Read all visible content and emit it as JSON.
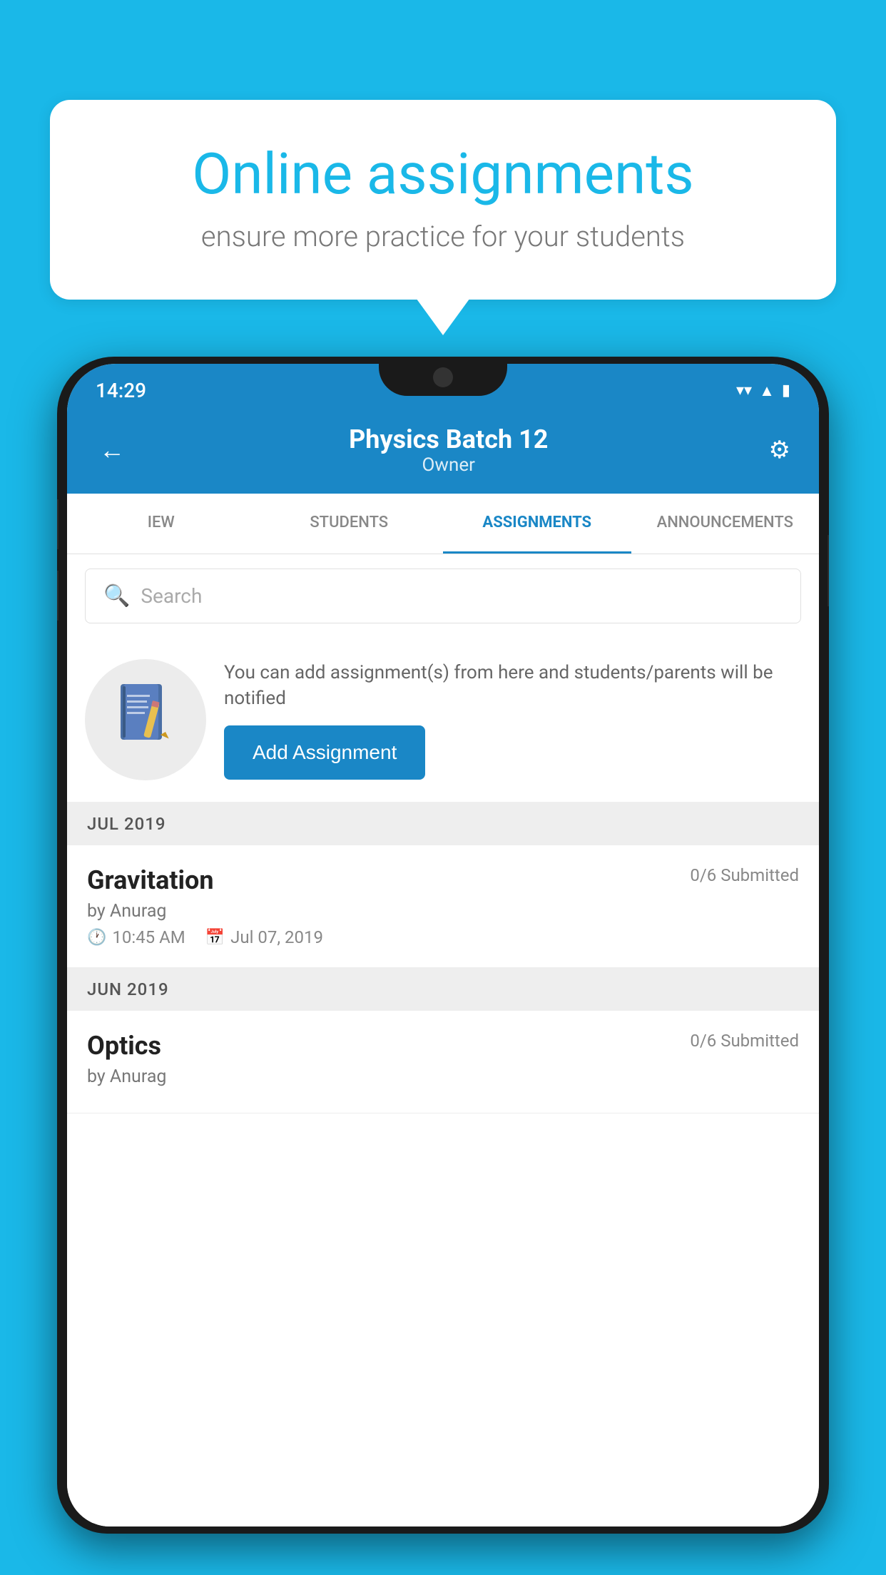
{
  "background_color": "#1ab8e8",
  "speech_bubble": {
    "title": "Online assignments",
    "subtitle": "ensure more practice for your students"
  },
  "phone": {
    "status_bar": {
      "time": "14:29",
      "wifi_icon": "wifi",
      "signal_icon": "signal",
      "battery_icon": "battery"
    },
    "header": {
      "title": "Physics Batch 12",
      "subtitle": "Owner",
      "back_label": "←",
      "settings_label": "⚙"
    },
    "tabs": [
      {
        "label": "IEW",
        "active": false
      },
      {
        "label": "STUDENTS",
        "active": false
      },
      {
        "label": "ASSIGNMENTS",
        "active": true
      },
      {
        "label": "ANNOUNCEMENTS",
        "active": false
      }
    ],
    "search": {
      "placeholder": "Search"
    },
    "promo": {
      "description": "You can add assignment(s) from here and students/parents will be notified",
      "button_label": "Add Assignment"
    },
    "sections": [
      {
        "month_label": "JUL 2019",
        "assignments": [
          {
            "name": "Gravitation",
            "submitted": "0/6 Submitted",
            "author": "by Anurag",
            "time": "10:45 AM",
            "date": "Jul 07, 2019"
          }
        ]
      },
      {
        "month_label": "JUN 2019",
        "assignments": [
          {
            "name": "Optics",
            "submitted": "0/6 Submitted",
            "author": "by Anurag",
            "time": "",
            "date": ""
          }
        ]
      }
    ]
  }
}
